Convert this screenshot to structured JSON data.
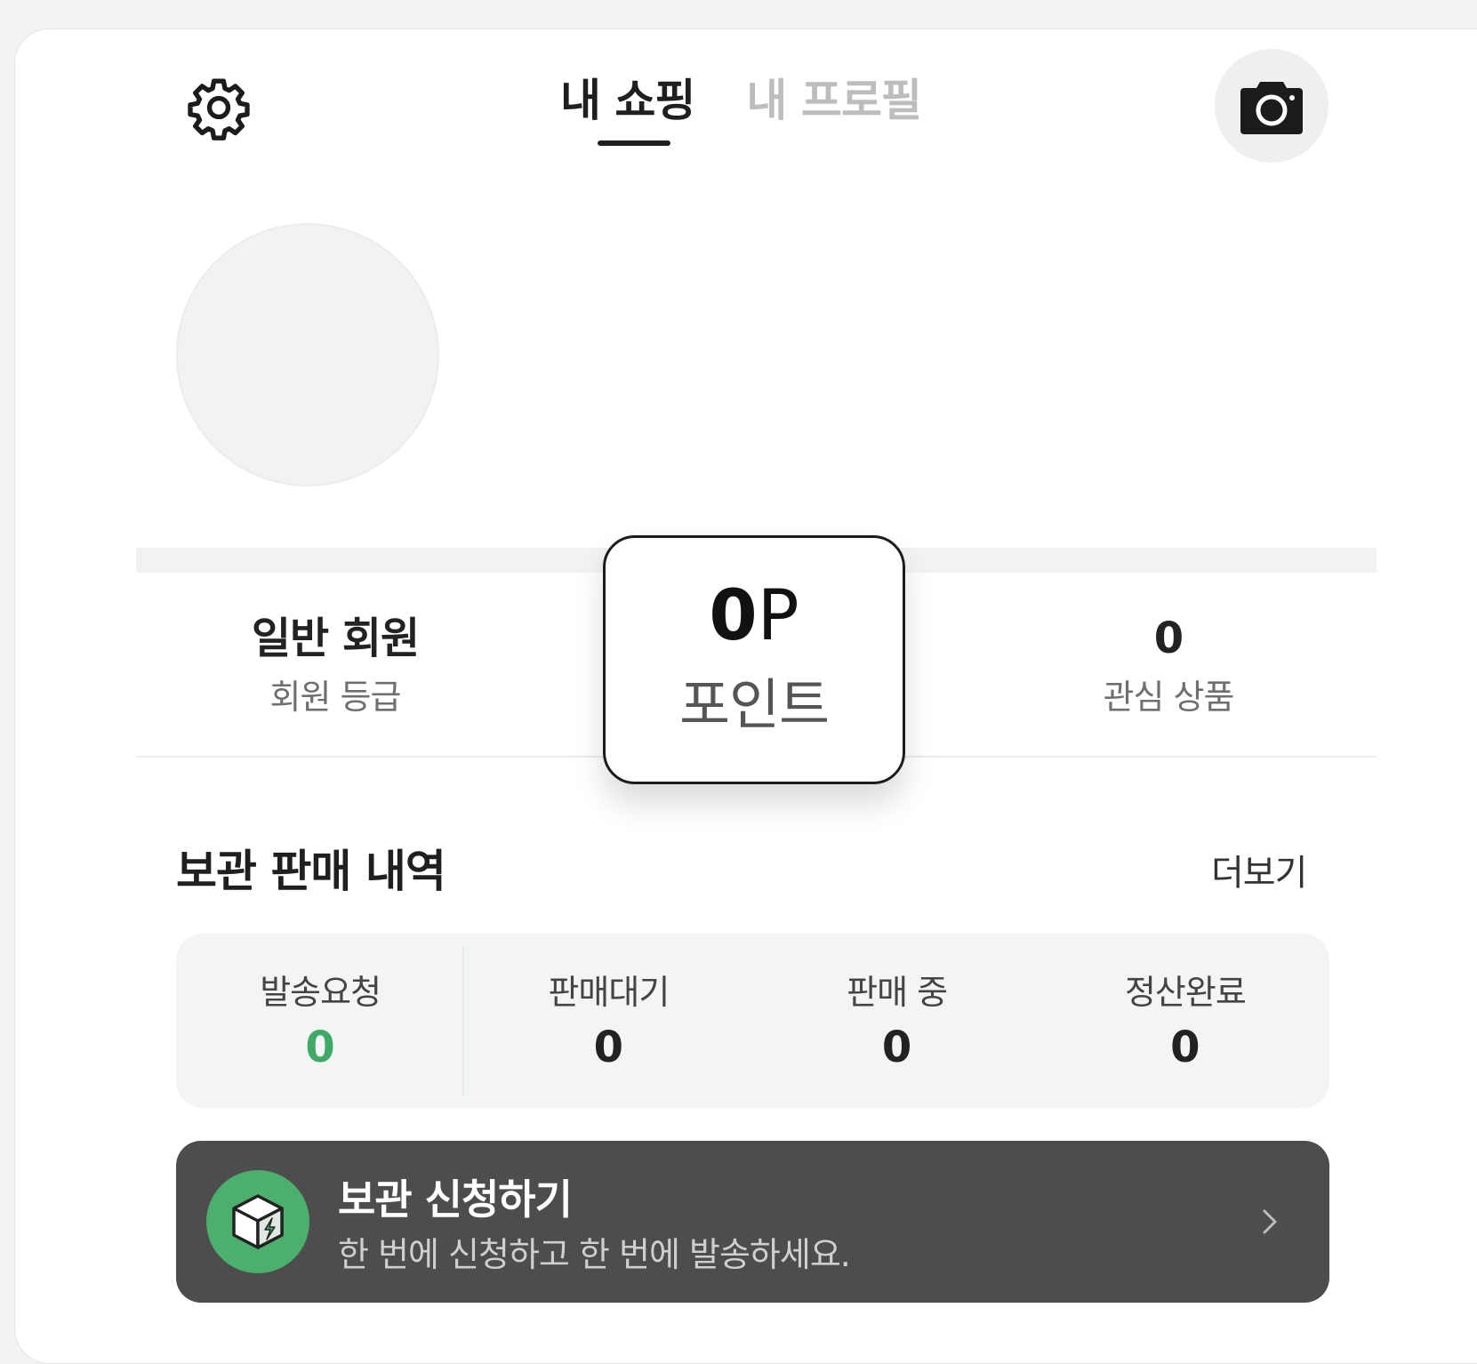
{
  "header": {
    "settings_icon": "gear-icon",
    "tabs": [
      {
        "label": "내 쇼핑",
        "active": true
      },
      {
        "label": "내 프로필",
        "active": false
      }
    ],
    "camera_icon": "camera-icon"
  },
  "profile": {
    "avatar": "empty-avatar"
  },
  "stats": {
    "grade": {
      "value": "일반 회원",
      "label": "회원 등급"
    },
    "points": {
      "value": "0",
      "unit": "P",
      "label": "포인트"
    },
    "wishlist": {
      "value": "0",
      "label": "관심 상품"
    }
  },
  "storage_sales": {
    "title": "보관 판매 내역",
    "more_label": "더보기",
    "items": [
      {
        "label": "발송요청",
        "count": "0"
      },
      {
        "label": "판매대기",
        "count": "0"
      },
      {
        "label": "판매 중",
        "count": "0"
      },
      {
        "label": "정산완료",
        "count": "0"
      }
    ],
    "highlight_color": "#3faa68"
  },
  "banner": {
    "icon": "box-lightning-icon",
    "title": "보관 신청하기",
    "subtitle": "한 번에 신청하고 한 번에 발송하세요.",
    "chevron_icon": "chevron-right-icon",
    "background": "#4d4d4d",
    "icon_color": "#4caf6e"
  }
}
